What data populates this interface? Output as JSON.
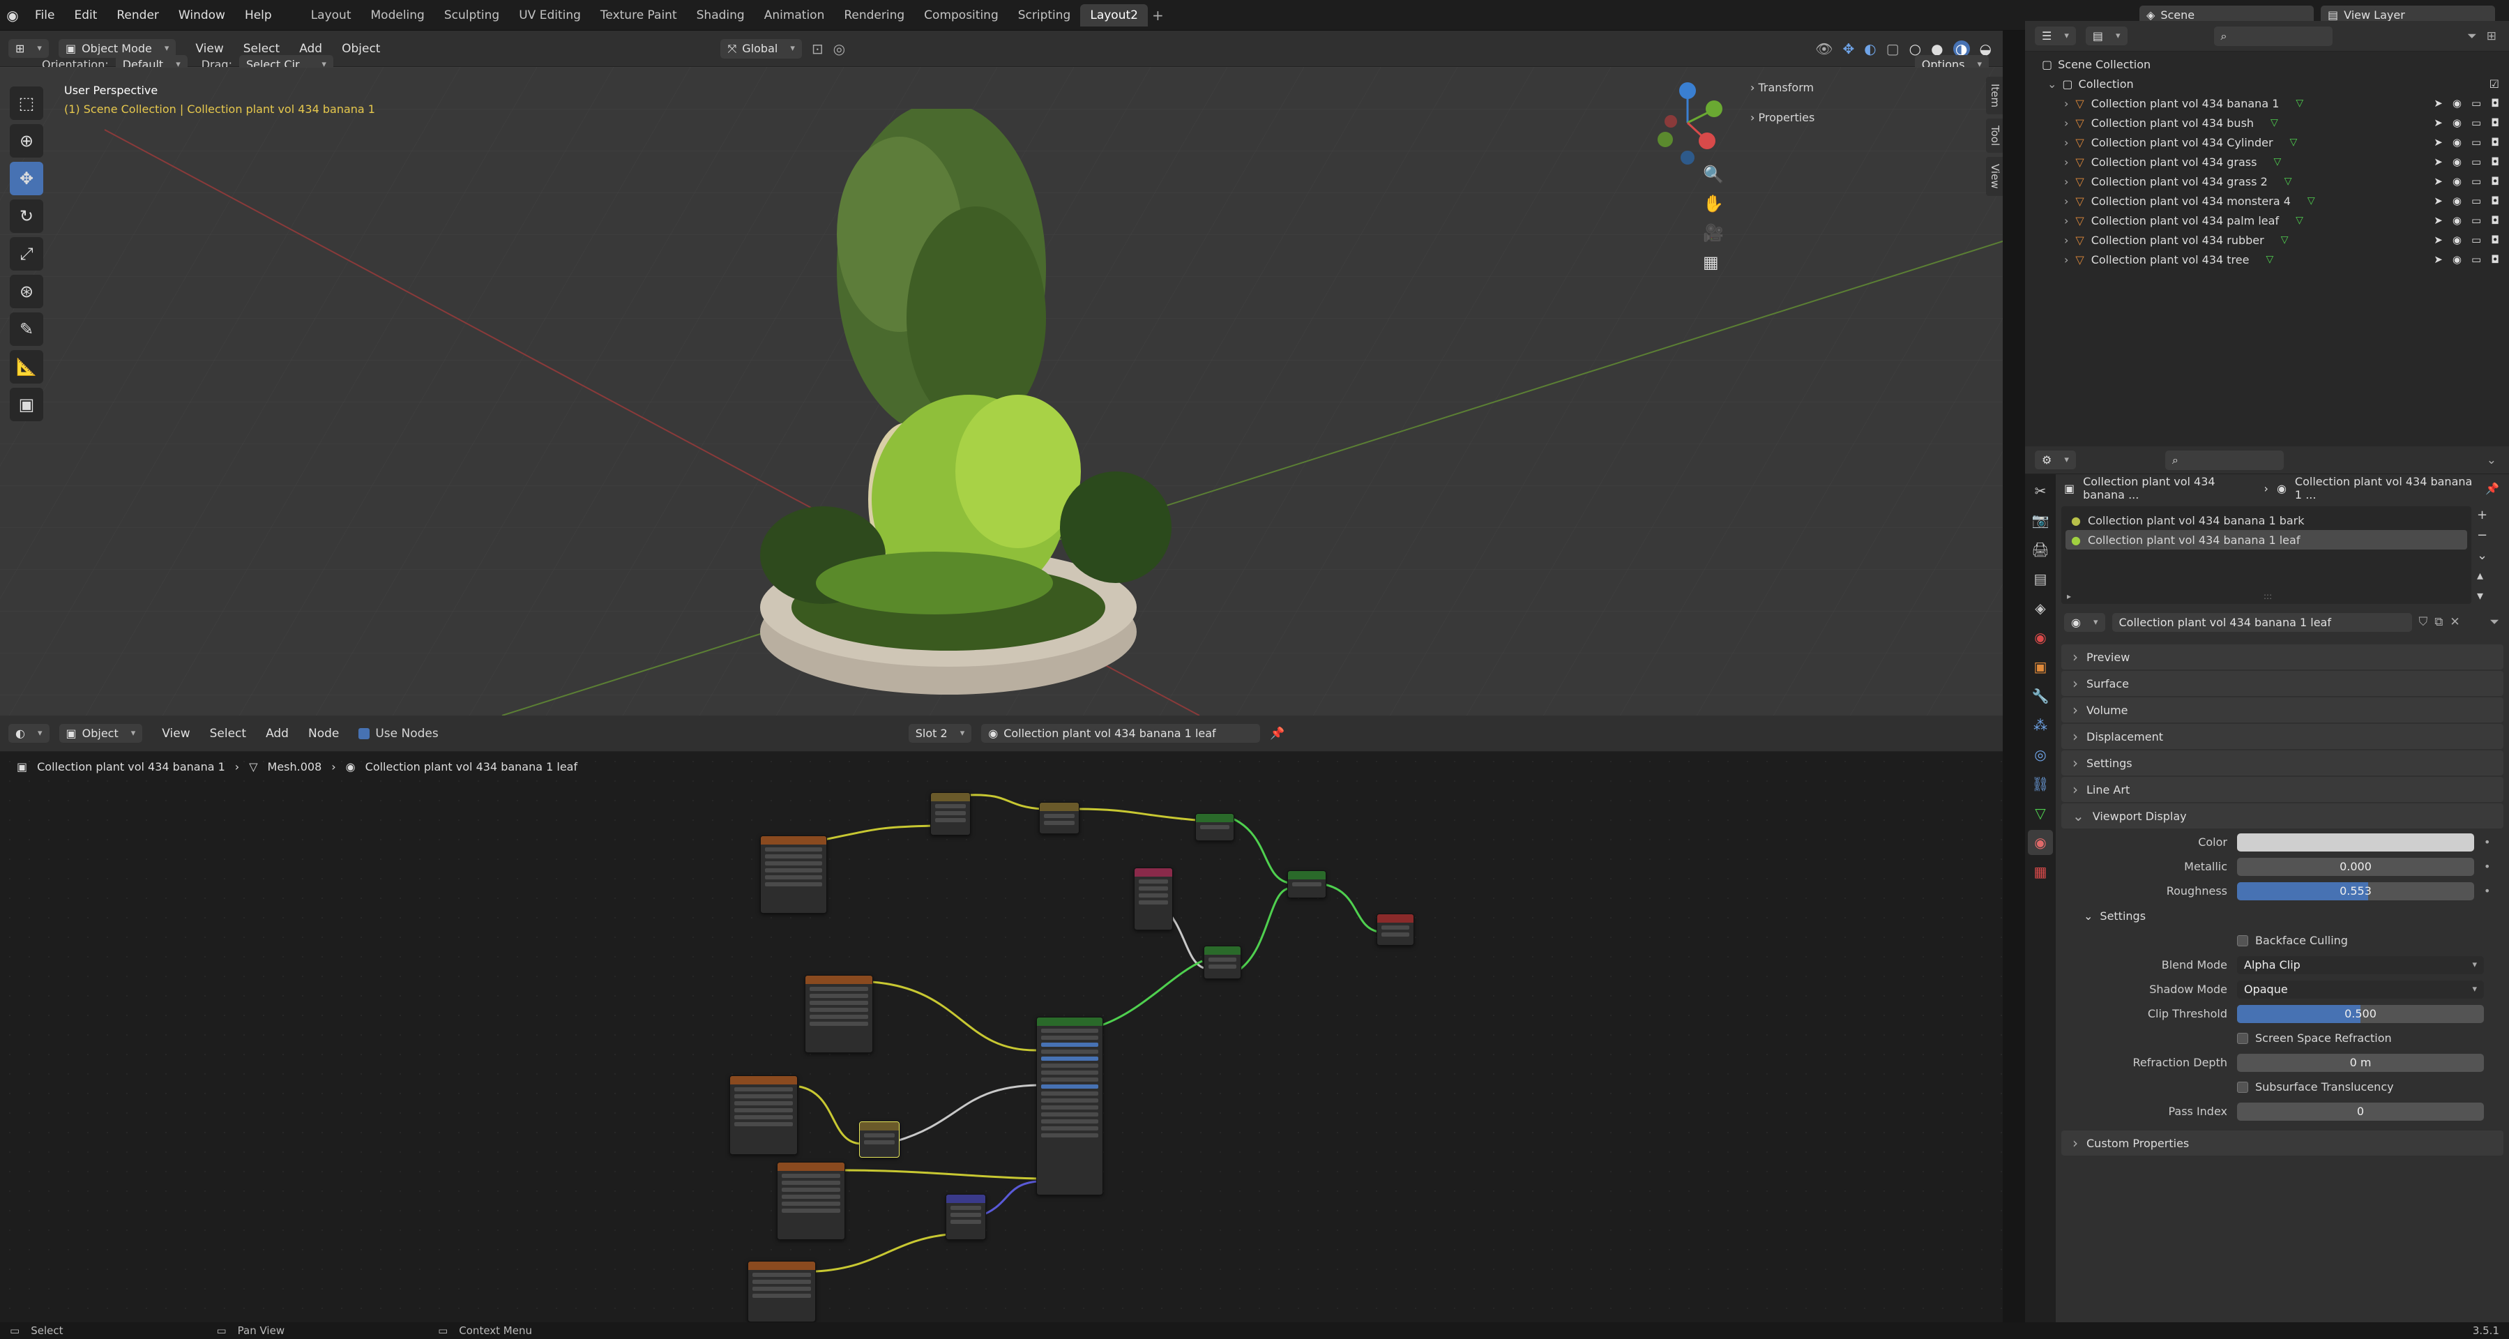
{
  "top_menu": [
    "File",
    "Edit",
    "Render",
    "Window",
    "Help"
  ],
  "workspaces": [
    "Layout",
    "Modeling",
    "Sculpting",
    "UV Editing",
    "Texture Paint",
    "Shading",
    "Animation",
    "Rendering",
    "Compositing",
    "Scripting",
    "Layout2"
  ],
  "active_workspace": "Layout2",
  "scene_name": "Scene",
  "view_layer_name": "View Layer",
  "viewport_header": {
    "mode": "Object Mode",
    "menus": [
      "View",
      "Select",
      "Add",
      "Object"
    ],
    "transform_orientation": "Global"
  },
  "viewport_tool_header": {
    "orientation_label": "Orientation:",
    "orientation_value": "Default",
    "drag_label": "Drag:",
    "drag_value": "Select Cir...",
    "options": "Options"
  },
  "viewport_overlay": {
    "line1": "User Perspective",
    "line2": "(1) Scene Collection | Collection plant vol 434 banana 1"
  },
  "n_panel": {
    "transform": "Transform",
    "properties": "Properties",
    "tabs": [
      "Item",
      "Tool",
      "View"
    ]
  },
  "node_header": {
    "mode": "Object",
    "menus": [
      "View",
      "Select",
      "Add",
      "Node"
    ],
    "use_nodes": "Use Nodes",
    "slot": "Slot 2",
    "material": "Collection plant vol 434 banana 1 leaf"
  },
  "node_breadcrumb": [
    "Collection plant vol 434 banana 1",
    "Mesh.008",
    "Collection plant vol 434 banana 1 leaf"
  ],
  "outliner": {
    "scene_collection": "Scene Collection",
    "collection": "Collection",
    "items": [
      "Collection plant vol 434 banana 1",
      "Collection plant vol 434 bush",
      "Collection plant vol 434 Cylinder",
      "Collection plant vol 434 grass",
      "Collection plant vol 434 grass 2",
      "Collection plant vol 434 monstera 4",
      "Collection plant vol 434 palm leaf",
      "Collection plant vol 434 rubber",
      "Collection plant vol 434 tree"
    ]
  },
  "properties": {
    "breadcrumb_object": "Collection plant vol 434 banana ...",
    "breadcrumb_material": "Collection plant vol 434 banana 1 ...",
    "material_slots": [
      "Collection plant vol 434 banana 1 bark",
      "Collection plant vol 434 banana 1 leaf"
    ],
    "active_material": "Collection plant vol 434 banana 1 leaf",
    "panels": [
      "Preview",
      "Surface",
      "Volume",
      "Displacement",
      "Settings",
      "Line Art"
    ],
    "viewport_display": "Viewport Display",
    "color_label": "Color",
    "metallic_label": "Metallic",
    "metallic_value": "0.000",
    "metallic_fraction": 0.0,
    "roughness_label": "Roughness",
    "roughness_value": "0.553",
    "roughness_fraction": 0.553,
    "settings_sub": "Settings",
    "backface_culling": "Backface Culling",
    "blend_mode_label": "Blend Mode",
    "blend_mode_value": "Alpha Clip",
    "shadow_mode_label": "Shadow Mode",
    "shadow_mode_value": "Opaque",
    "clip_threshold_label": "Clip Threshold",
    "clip_threshold_value": "0.500",
    "clip_threshold_fraction": 0.5,
    "ssr": "Screen Space Refraction",
    "refraction_depth_label": "Refraction Depth",
    "refraction_depth_value": "0 m",
    "subsurface": "Subsurface Translucency",
    "pass_index_label": "Pass Index",
    "pass_index_value": "0",
    "custom_properties": "Custom Properties"
  },
  "status_bar": {
    "select": "Select",
    "pan": "Pan View",
    "context": "Context Menu",
    "version": "3.5.1"
  },
  "colors": {
    "accent": "#4772b3",
    "viewport_bg": "#393939",
    "node_bg": "#1d1d1d",
    "header_bg": "#303030"
  }
}
